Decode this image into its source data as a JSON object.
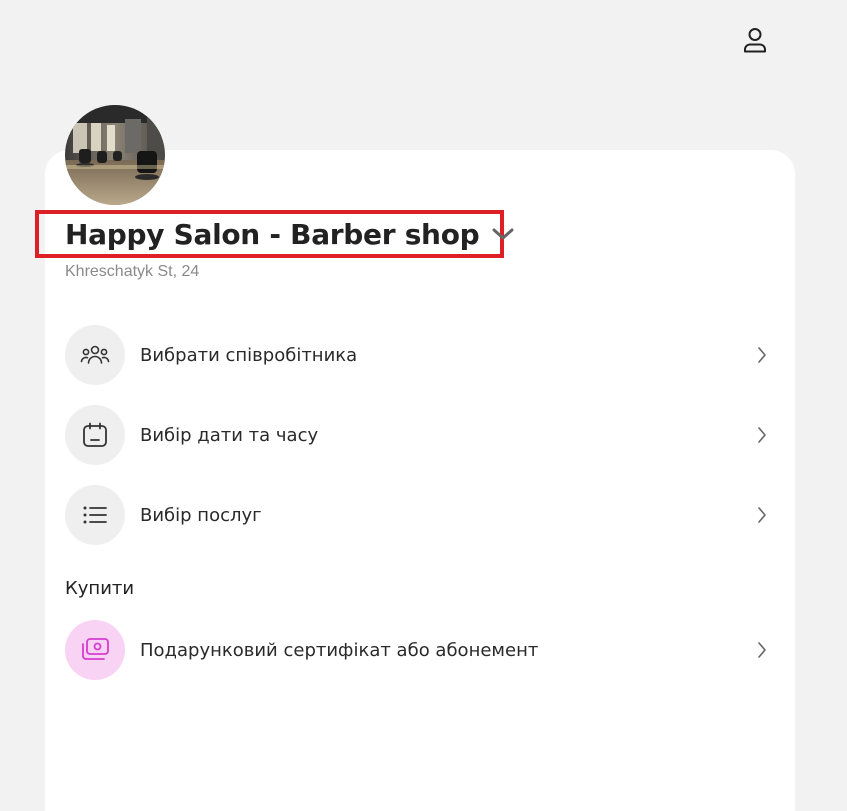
{
  "header": {
    "profile_icon": "user-icon"
  },
  "salon": {
    "name": "Happy Salon - Barber shop",
    "address": "Khreschatyk St, 24",
    "chevron_icon": "chevron-down-icon"
  },
  "menu": {
    "items": [
      {
        "label": "Вибрати співробітника",
        "icon": "users-icon"
      },
      {
        "label": "Вибір дати та часу",
        "icon": "calendar-icon"
      },
      {
        "label": "Вибір послуг",
        "icon": "list-icon"
      }
    ]
  },
  "buy": {
    "title": "Купити",
    "items": [
      {
        "label": "Подарунковий сертифікат або абонемент",
        "icon": "gift-certificate-icon",
        "icon_color": "#d63ed0",
        "icon_bg": "#f8d3f4"
      }
    ]
  }
}
